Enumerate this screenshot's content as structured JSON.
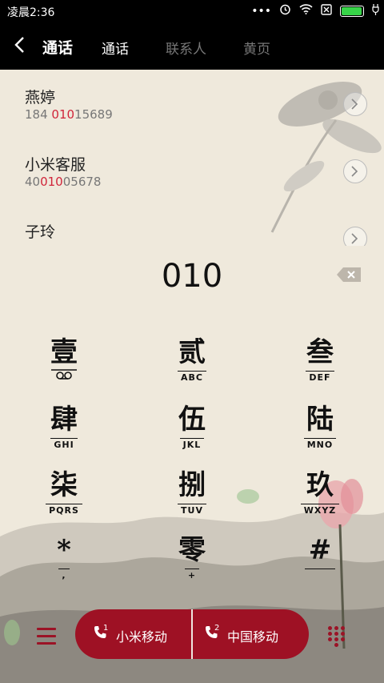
{
  "status_bar": {
    "time": "凌晨2:36",
    "battery_level": 0.95,
    "accent": "#37d448"
  },
  "header": {
    "title": "通话",
    "tabs": [
      {
        "label": "通话",
        "active": true
      },
      {
        "label": "联系人",
        "active": false
      },
      {
        "label": "黄页",
        "active": false
      }
    ]
  },
  "contacts": [
    {
      "name": "燕婷",
      "number_pre": "184 ",
      "number_hl": "010",
      "number_post": "15689"
    },
    {
      "name": "小米客服",
      "number_pre": "40",
      "number_hl": "010",
      "number_post": "05678"
    },
    {
      "name": "子玲",
      "number_pre": "",
      "number_hl": "",
      "number_post": ""
    }
  ],
  "dial": {
    "number": "010"
  },
  "keypad": [
    {
      "glyph": "壹",
      "letters": "",
      "icon": "voicemail-icon"
    },
    {
      "glyph": "贰",
      "letters": "ABC"
    },
    {
      "glyph": "叁",
      "letters": "DEF"
    },
    {
      "glyph": "肆",
      "letters": "GHI"
    },
    {
      "glyph": "伍",
      "letters": "JKL"
    },
    {
      "glyph": "陆",
      "letters": "MNO"
    },
    {
      "glyph": "柒",
      "letters": "PQRS"
    },
    {
      "glyph": "捌",
      "letters": "TUV"
    },
    {
      "glyph": "玖",
      "letters": "WXYZ"
    },
    {
      "glyph": "*",
      "letters": ","
    },
    {
      "glyph": "零",
      "letters": "+"
    },
    {
      "glyph": "#",
      "letters": ""
    }
  ],
  "bottom": {
    "sim1_label": "小米移动",
    "sim1_num": "1",
    "sim2_label": "中国移动",
    "sim2_num": "2",
    "accent": "#9e1124"
  }
}
